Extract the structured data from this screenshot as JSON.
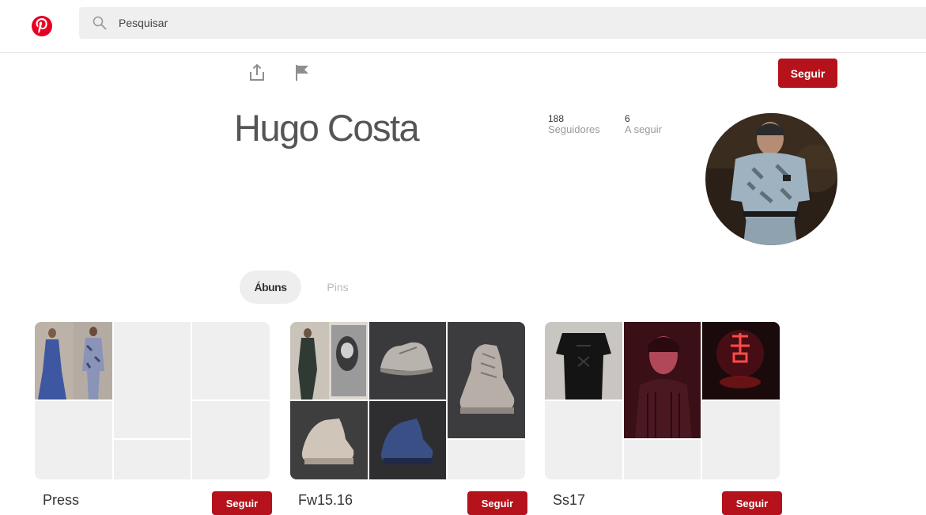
{
  "colors": {
    "brand": "#e60023",
    "follow_button": "#b5121b",
    "placeholder_tile": "#efefef"
  },
  "header": {
    "logo_icon": "pinterest-logo-icon",
    "search": {
      "icon": "search-icon",
      "placeholder": "Pesquisar",
      "value": ""
    }
  },
  "profile": {
    "share_icon": "share-upload-icon",
    "report_icon": "flag-icon",
    "follow_label": "Seguir",
    "name": "Hugo Costa",
    "followers": {
      "count": "188",
      "label": "Seguidores"
    },
    "following": {
      "count": "6",
      "label": "A seguir"
    },
    "avatar_icon": "profile-avatar-image"
  },
  "tabs": [
    {
      "label": "Ábuns",
      "active": true
    },
    {
      "label": "Pins",
      "active": false
    }
  ],
  "boards": [
    {
      "title": "Press",
      "follow_label": "Seguir"
    },
    {
      "title": "Fw15.16",
      "follow_label": "Seguir"
    },
    {
      "title": "Ss17",
      "follow_label": "Seguir"
    }
  ]
}
